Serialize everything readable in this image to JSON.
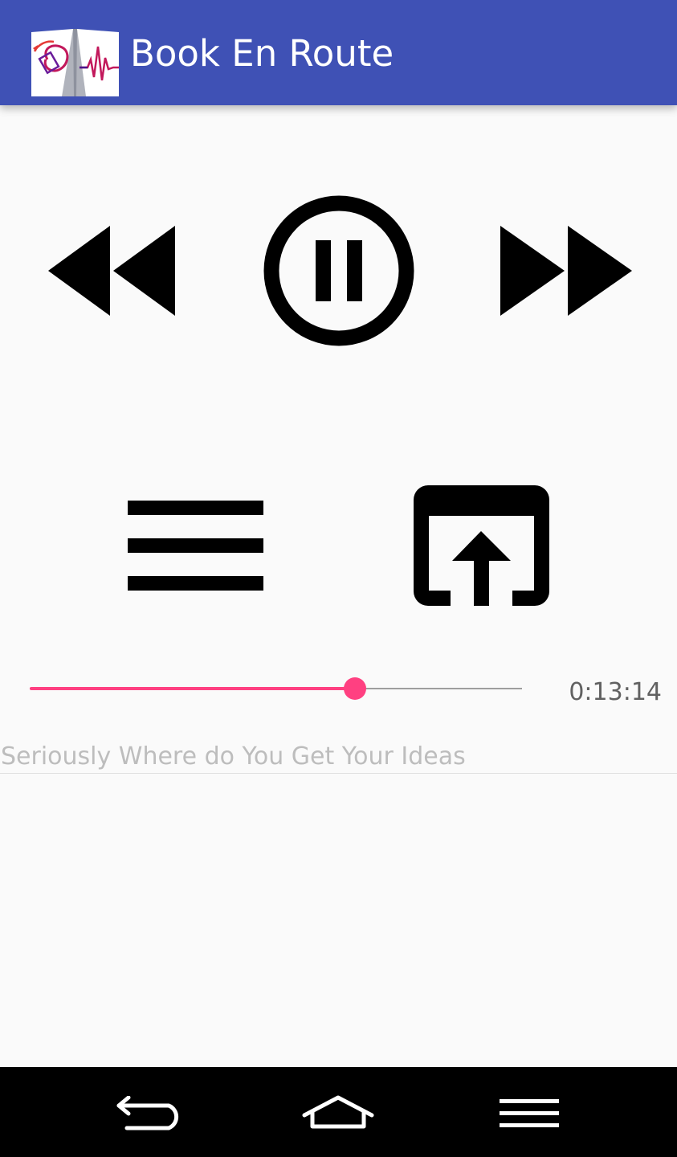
{
  "app_bar": {
    "title": "Book En Route",
    "background_color": "#3F51B5",
    "logo_icon": "book-heartbeat-logo"
  },
  "player": {
    "controls": [
      {
        "id": "rewind",
        "icon": "fast-rewind-icon"
      },
      {
        "id": "play-pause",
        "icon": "pause-circle-icon",
        "state": "playing"
      },
      {
        "id": "fast-forward",
        "icon": "fast-forward-icon"
      }
    ],
    "actions": [
      {
        "id": "menu",
        "icon": "menu-icon"
      },
      {
        "id": "open",
        "icon": "open-in-browser-icon"
      }
    ],
    "progress_fraction": 0.66,
    "elapsed": "0:13:14",
    "track_title": "Seriously Where do You Get Your Ideas",
    "accent_color": "#FF4081"
  },
  "system_nav": {
    "buttons": [
      {
        "id": "back",
        "icon": "back-arrow-icon"
      },
      {
        "id": "home",
        "icon": "home-icon"
      },
      {
        "id": "recents",
        "icon": "menu-lines-icon"
      }
    ]
  }
}
